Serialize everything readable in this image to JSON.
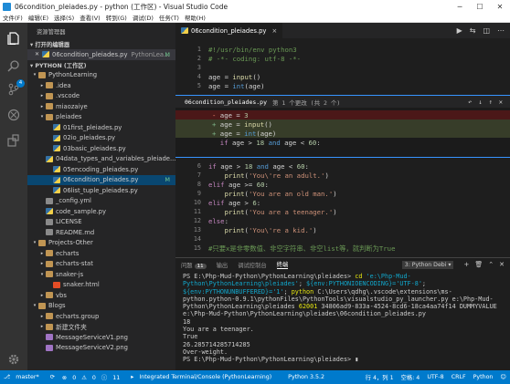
{
  "window": {
    "title": "06condition_pleiades.py - python (工作区) - Visual Studio Code"
  },
  "menu": [
    "文件(F)",
    "编辑(E)",
    "选择(S)",
    "查看(V)",
    "转到(G)",
    "调试(D)",
    "任务(T)",
    "帮助(H)"
  ],
  "sidebar": {
    "title": "资源管理器",
    "open_editors_label": "▾ 打开的编辑器",
    "open_file": {
      "name": "06condition_pleiades.py",
      "path": "PythonLea...",
      "badge": "M"
    },
    "workspace_label": "▾ PYTHON (工作区)",
    "tree": [
      {
        "label": "PythonLearning",
        "type": "folder",
        "indent": 1,
        "arrow": "▾"
      },
      {
        "label": ".idea",
        "type": "folder",
        "indent": 2,
        "arrow": "▸"
      },
      {
        "label": ".vscode",
        "type": "folder",
        "indent": 2,
        "arrow": "▸"
      },
      {
        "label": "miaozaiye",
        "type": "folder",
        "indent": 2,
        "arrow": "▸"
      },
      {
        "label": "pleiades",
        "type": "folder",
        "indent": 2,
        "arrow": "▾"
      },
      {
        "label": "01first_pleiades.py",
        "type": "py",
        "indent": 3
      },
      {
        "label": "02io_pleiades.py",
        "type": "py",
        "indent": 3
      },
      {
        "label": "03basic_pleiades.py",
        "type": "py",
        "indent": 3
      },
      {
        "label": "04data_types_and_variables_pleiade...",
        "type": "py",
        "indent": 3
      },
      {
        "label": "05encoding_pleiades.py",
        "type": "py",
        "indent": 3
      },
      {
        "label": "06condition_pleiades.py",
        "type": "py",
        "indent": 3,
        "selected": true,
        "badge": "M"
      },
      {
        "label": "06list_tuple_pleiades.py",
        "type": "py",
        "indent": 3
      },
      {
        "label": "_config.yml",
        "type": "txt",
        "indent": 2
      },
      {
        "label": "code_sample.py",
        "type": "py",
        "indent": 2
      },
      {
        "label": "LICENSE",
        "type": "txt",
        "indent": 2
      },
      {
        "label": "README.md",
        "type": "txt",
        "indent": 2
      },
      {
        "label": "Projects-Other",
        "type": "folder",
        "indent": 1,
        "arrow": "▾"
      },
      {
        "label": "echarts",
        "type": "folder",
        "indent": 2,
        "arrow": "▸"
      },
      {
        "label": "echarts-stat",
        "type": "folder",
        "indent": 2,
        "arrow": "▸"
      },
      {
        "label": "snaker-js",
        "type": "folder",
        "indent": 2,
        "arrow": "▾"
      },
      {
        "label": "snaker.html",
        "type": "html",
        "indent": 3
      },
      {
        "label": "vbs",
        "type": "folder",
        "indent": 2,
        "arrow": "▸"
      },
      {
        "label": "Blogs",
        "type": "folder",
        "indent": 1,
        "arrow": "▾"
      },
      {
        "label": "echarts.group",
        "type": "folder",
        "indent": 2,
        "arrow": "▸"
      },
      {
        "label": "新建文件夹",
        "type": "folder",
        "indent": 2,
        "arrow": "▸"
      },
      {
        "label": "MessageServiceV1.png",
        "type": "png",
        "indent": 2
      },
      {
        "label": "MessageServiceV2.png",
        "type": "png",
        "indent": 2
      }
    ]
  },
  "editor": {
    "tab_label": "06condition_pleiades.py",
    "tab_close": "×",
    "peek": {
      "file": "06condition_pleiades.py",
      "desc": "第 1 个更改 (共 2 个)"
    }
  },
  "panel": {
    "tabs": [
      "问题",
      "输出",
      "调试控制台",
      "终端"
    ],
    "problems_count": "11",
    "terminal_select": "3: Python Debi ▾"
  },
  "statusbar": {
    "branch": "master*",
    "sync": "⟳",
    "errors": "0",
    "warnings": "0",
    "info": "11",
    "terminal": "Integrated Terminal/Console (PythonLearning)",
    "python": "Python 3.5.2",
    "position": "行 4，列 1",
    "spaces": "空格: 4",
    "encoding": "UTF-8",
    "eol": "CRLF",
    "language": "Python"
  }
}
